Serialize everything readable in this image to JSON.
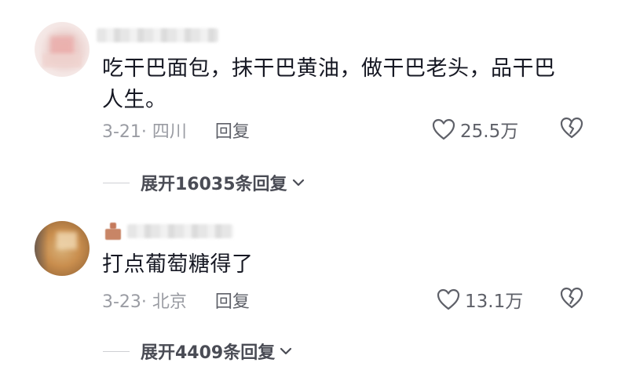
{
  "comments": [
    {
      "text": "吃干巴面包，抹干巴黄油，做干巴老头，品干巴人生。",
      "date_location": "3-21· 四川",
      "reply_label": "回复",
      "like_count": "25.5万",
      "expand_label": "展开16035条回复"
    },
    {
      "text": "打点葡萄糖得了",
      "date_location": "3-23· 北京",
      "reply_label": "回复",
      "like_count": "13.1万",
      "expand_label": "展开4409条回复"
    }
  ],
  "icons": {
    "like": "heart-outline-icon",
    "dislike": "broken-heart-icon",
    "expand": "chevron-down-icon"
  },
  "colors": {
    "text_primary": "#161823",
    "text_secondary": "#9a9ca3",
    "action_text": "#5e6068"
  }
}
